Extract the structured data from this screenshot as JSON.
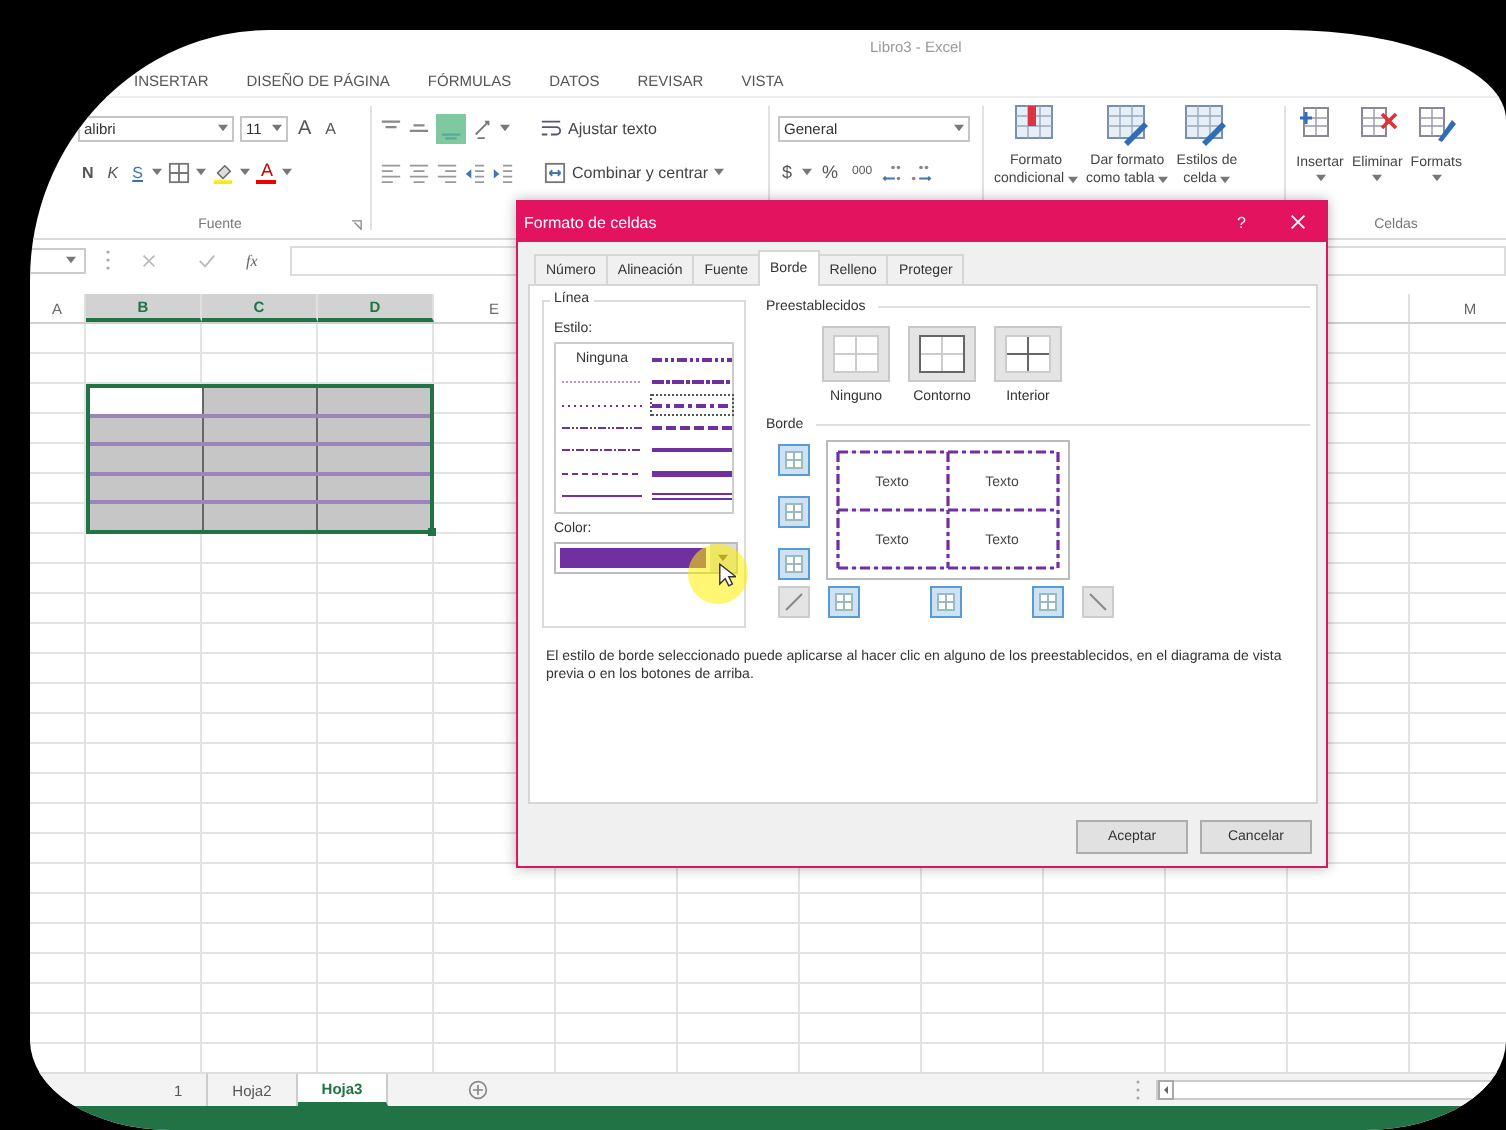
{
  "window": {
    "title": "Libro3 - Excel"
  },
  "ribbon_tabs": [
    "INSERTAR",
    "DISEÑO DE PÁGINA",
    "FÓRMULAS",
    "DATOS",
    "REVISAR",
    "VISTA"
  ],
  "ribbon": {
    "font": {
      "name": "alibri",
      "size": "11",
      "grow": "A",
      "shrink": "A",
      "bold": "N",
      "italic": "K",
      "underline": "S",
      "font_color": "A",
      "group_label": "Fuente"
    },
    "alignment": {
      "wrap_text": "Ajustar texto",
      "merge": "Combinar y centrar"
    },
    "number": {
      "format": "General",
      "currency": "$",
      "percent": "%",
      "thousands": "000"
    },
    "styles": [
      {
        "lines": [
          "Formato",
          "condicional"
        ]
      },
      {
        "lines": [
          "Dar formato",
          "como tabla"
        ]
      },
      {
        "lines": [
          "Estilos de",
          "celda"
        ]
      }
    ],
    "cells": {
      "buttons": [
        "Insertar",
        "Eliminar",
        "Formats"
      ],
      "group_label": "Celdas"
    }
  },
  "formula_bar": {
    "function_button": "fx"
  },
  "sheet": {
    "columns": [
      {
        "label": "A",
        "selected": false
      },
      {
        "label": "B",
        "selected": true
      },
      {
        "label": "C",
        "selected": true
      },
      {
        "label": "D",
        "selected": true
      },
      {
        "label": "E",
        "selected": false
      }
    ],
    "last_column": "M"
  },
  "sheet_tabs": [
    {
      "label": "1",
      "selected": false
    },
    {
      "label": "Hoja2",
      "selected": false
    },
    {
      "label": "Hoja3",
      "selected": true
    }
  ],
  "dialog": {
    "title": "Formato de celdas",
    "help": "?",
    "tabs": [
      {
        "label": "Número",
        "selected": false
      },
      {
        "label": "Alineación",
        "selected": false
      },
      {
        "label": "Fuente",
        "selected": false
      },
      {
        "label": "Borde",
        "selected": true
      },
      {
        "label": "Relleno",
        "selected": false
      },
      {
        "label": "Proteger",
        "selected": false
      }
    ],
    "line": {
      "title": "Línea",
      "style_label": "Estilo:",
      "color_label": "Color:",
      "color": "#7030a0",
      "styles": [
        {
          "kind": "none",
          "label": "Ninguna",
          "selected": false
        },
        {
          "kind": "hair",
          "selected": false
        },
        {
          "kind": "dotted",
          "selected": false
        },
        {
          "kind": "dashdotdot",
          "selected": false
        },
        {
          "kind": "dashdot",
          "selected": false
        },
        {
          "kind": "dashed",
          "selected": false
        },
        {
          "kind": "thin",
          "selected": false
        },
        {
          "kind": "medium_dashdotdot",
          "selected": false
        },
        {
          "kind": "slant_dashdot",
          "selected": false
        },
        {
          "kind": "medium_dashdot",
          "selected": true
        },
        {
          "kind": "medium_dashed",
          "selected": false
        },
        {
          "kind": "medium",
          "selected": false
        },
        {
          "kind": "thick",
          "selected": false
        },
        {
          "kind": "double",
          "selected": false
        }
      ]
    },
    "presets": {
      "title": "Preestablecidos",
      "items": [
        {
          "kind": "none",
          "label": "Ninguno"
        },
        {
          "kind": "outline",
          "label": "Contorno"
        },
        {
          "kind": "inside",
          "label": "Interior"
        }
      ]
    },
    "border": {
      "title": "Borde",
      "preview_texts": [
        "Texto",
        "Texto",
        "Texto",
        "Texto"
      ],
      "side_buttons": [
        {
          "kind": "top",
          "on": true
        },
        {
          "kind": "middle",
          "on": true
        },
        {
          "kind": "bottom",
          "on": true
        }
      ],
      "bottom_buttons": [
        {
          "kind": "diagonal_up",
          "on": false
        },
        {
          "kind": "left",
          "on": true
        },
        {
          "kind": "center",
          "on": true
        },
        {
          "kind": "right",
          "on": true
        },
        {
          "kind": "diagonal_down",
          "on": false
        }
      ]
    },
    "description": "El estilo de borde seleccionado puede aplicarse al hacer clic en alguno de los preestablecidos, en el diagrama de vista previa o en los botones de arriba.",
    "buttons": [
      "Aceptar",
      "Cancelar"
    ]
  }
}
